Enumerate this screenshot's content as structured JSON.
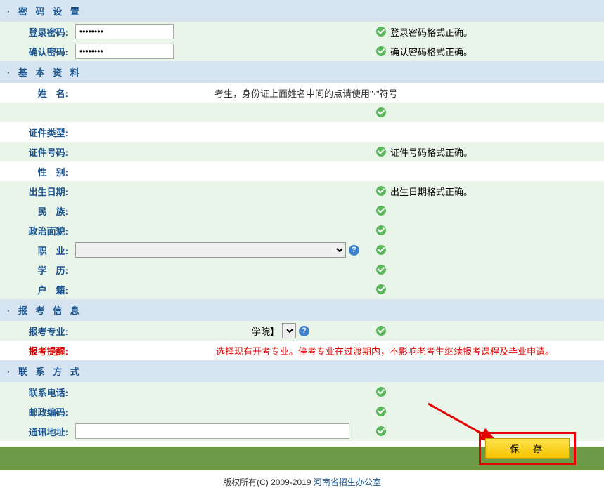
{
  "sections": {
    "password": {
      "title": "密 码 设 置"
    },
    "basic": {
      "title": "基 本 资 料"
    },
    "apply": {
      "title": "报 考 信 息"
    },
    "contact": {
      "title": "联 系 方 式"
    }
  },
  "password": {
    "login_label": "登录密码:",
    "login_value": "••••••••",
    "login_status": "登录密码格式正确。",
    "confirm_label": "确认密码:",
    "confirm_value": "••••••••",
    "confirm_status": "确认密码格式正确。"
  },
  "basic": {
    "name_label": "姓　名:",
    "name_hint": "考生，身份证上面姓名中间的点请使用\"·\"符号",
    "idtype_label": "证件类型:",
    "idnum_label": "证件号码:",
    "idnum_status": "证件号码格式正确。",
    "gender_label": "性　别:",
    "birth_label": "出生日期:",
    "birth_status": "出生日期格式正确。",
    "nation_label": "民　族:",
    "political_label": "政治面貌:",
    "occupation_label": "职　业:",
    "education_label": "学　历:",
    "household_label": "户　籍:"
  },
  "apply": {
    "major_label": "报考专业:",
    "major_suffix": "学院】",
    "notice_label": "报考提醒:",
    "notice_text": "选择现有开考专业。停考专业在过渡期内，不影响老考生继续报考课程及毕业申请。"
  },
  "contact": {
    "phone_label": "联系电话:",
    "postal_label": "邮政编码:",
    "address_label": "通讯地址:"
  },
  "buttons": {
    "save": "保 存"
  },
  "footer": {
    "copyright_prefix": "版权所有(C) 2009-2019 ",
    "org": "河南省招生办公室"
  }
}
